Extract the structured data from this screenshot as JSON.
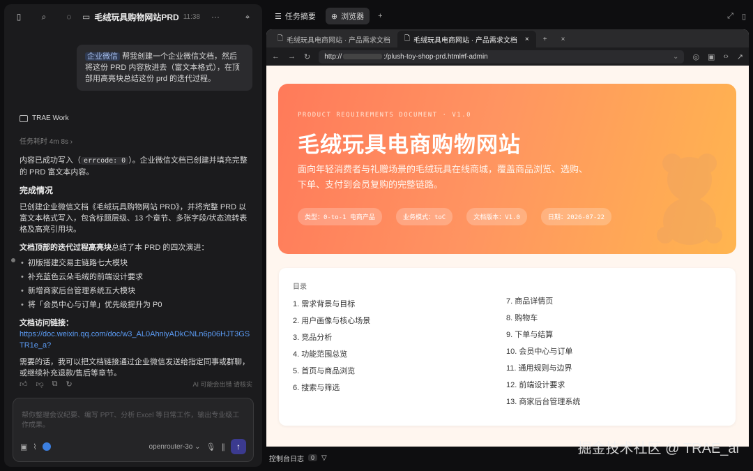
{
  "left": {
    "title": "毛绒玩具购物网站PRD",
    "time": "11:38",
    "user_message": {
      "tag": "企业微信",
      "text": "帮我创建一个企业微信文档，然后将这份 PRD 内容放进去（富文本格式），在顶部用高亮块总结这份 prd 的迭代过程。"
    },
    "agent_name": "TRAE Work",
    "task_time": "任务耗时 4m 8s",
    "reply": {
      "p1_a": "内容已成功写入（",
      "p1_code": "errcode: 0",
      "p1_b": "）。企业微信文档已创建并填充完整的 PRD 富文本内容。",
      "heading": "完成情况",
      "p2": "已创建企业微信文档《毛绒玩具购物网站 PRD》，并将完整 PRD 以富文本格式写入，包含标题层级、13 个章节、多张字段/状态流转表格及高亮引用块。",
      "p3_bold": "文档顶部的迭代过程高亮块",
      "p3_rest": "总结了本 PRD 的四次演进：",
      "bullets": [
        "初版搭建交易主链路七大模块",
        "补充蓝色云朵毛绒的前端设计要求",
        "新增商家后台管理系统五大模块",
        "将「会员中心与订单」优先级提升为 P0"
      ],
      "link_label": "文档访问链接：",
      "link": "https://doc.weixin.qq.com/doc/w3_AL0AhniyADkCNLn6p06HJT3GSTR1e_a?",
      "p4": "需要的话，我可以把文档链接通过企业微信发送给指定同事或群聊，或继续补充退款/售后等章节。"
    },
    "ai_note": "AI 可能会出错 请核实",
    "composer_placeholder": "帮你整理会议纪要、编写 PPT、分析 Excel 等日常工作，输出专业级工作成果。",
    "model": "openrouter-3o"
  },
  "right": {
    "tabs": [
      "任务摘要",
      "浏览器"
    ],
    "browser_tabs": [
      "毛绒玩具电商网站 · 产品需求文档",
      "毛绒玩具电商网站 · 产品需求文档"
    ],
    "url_prefix": "http://",
    "url_suffix": ":/plush-toy-shop-prd.html#f-admin",
    "hero": {
      "kicker": "PRODUCT REQUIREMENTS DOCUMENT · V1.0",
      "title": "毛绒玩具电商购物网站",
      "subtitle": "面向年轻消费者与礼赠场景的毛绒玩具在线商城，覆盖商品浏览、选购、下单、支付到会员复购的完整链路。",
      "pills": [
        "类型：0-to-1 电商产品",
        "业务模式：toC",
        "文档版本：V1.0",
        "日期：2026-07-22"
      ]
    },
    "toc": {
      "label": "目录",
      "col1": [
        "1. 需求背景与目标",
        "2. 用户画像与核心场景",
        "3. 竞品分析",
        "4. 功能范围总览",
        "5. 首页与商品浏览",
        "6. 搜索与筛选"
      ],
      "col2": [
        "7. 商品详情页",
        "8. 购物车",
        "9. 下单与结算",
        "10. 会员中心与订单",
        "11. 通用规则与边界",
        "12. 前端设计要求",
        "13. 商家后台管理系统"
      ]
    },
    "console_label": "控制台日志",
    "console_count": "0"
  },
  "watermark": "掘金技术社区 @ TRAE_ai"
}
